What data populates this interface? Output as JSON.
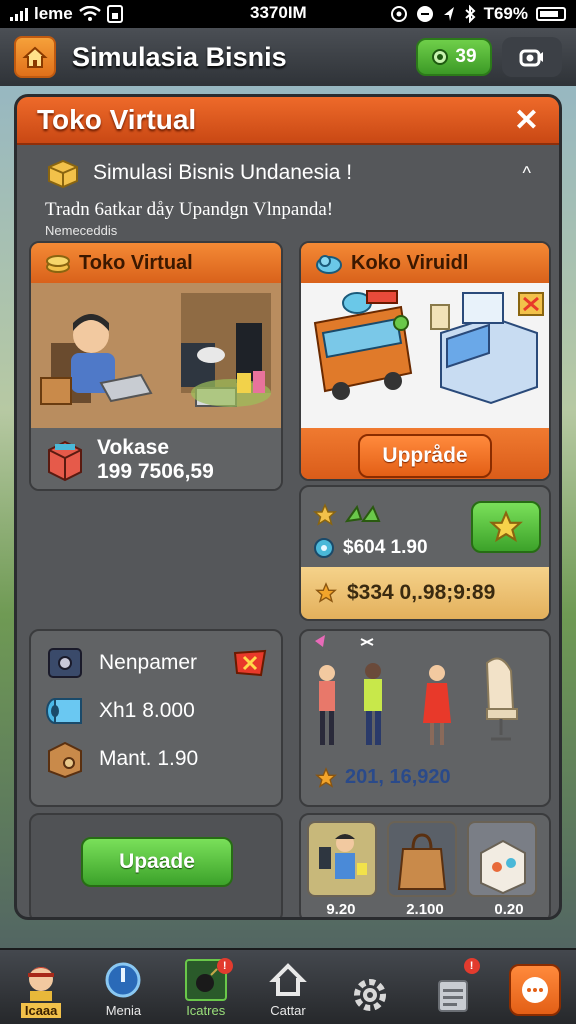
{
  "status_bar": {
    "carrier": "leme",
    "time": "3370IM",
    "battery": "T69%"
  },
  "top_bar": {
    "title": "Simulasia Bisnis",
    "coins": "39"
  },
  "panel": {
    "title": "Toko Virtual",
    "close": "✕",
    "info_title": "Simulasi Bisnis Undanesia !",
    "tagline": "Tradn 6atkar dåy Upandgn Vlnpanda!",
    "subnote": "Nemeceddis"
  },
  "card_left_top": {
    "header": "Toko Virtual",
    "item_label": "Vokase",
    "item_value": "199 7506,59"
  },
  "card_right_top": {
    "header": "Koko Viruidl",
    "upgrade_label": "Uppråde",
    "stat_value": "$604 1.90",
    "total_value": "$334 0,.98;9:89"
  },
  "card_left_mid": {
    "row1": "Nenpamer",
    "row2": "Xh1 8.000",
    "row3": "Mant. 1.90"
  },
  "card_right_mid": {
    "value": "201, 16,920"
  },
  "upgrade_button": "Upaade",
  "thumb_prices": [
    "9.20",
    "2.100",
    "0.20"
  ],
  "bottom_nav": [
    {
      "label": "Icaaa"
    },
    {
      "label": "Menia"
    },
    {
      "label": "Icatres"
    },
    {
      "label": "Cattar"
    },
    {
      "label": ""
    },
    {
      "label": ""
    },
    {
      "label": ""
    }
  ],
  "colors": {
    "accent_orange": "#e0621c",
    "accent_green": "#3ca22a",
    "panel_gray": "#55575a"
  }
}
